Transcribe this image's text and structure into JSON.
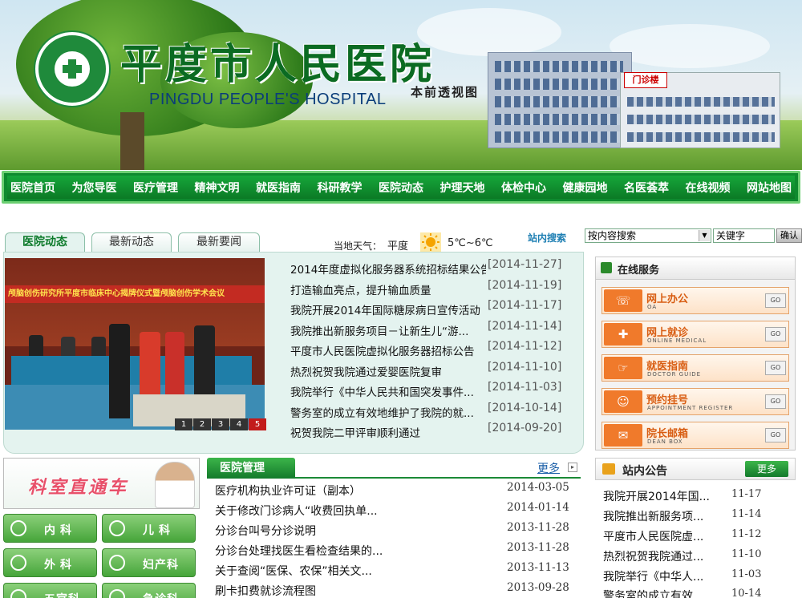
{
  "header": {
    "title_cn": "平度市人民医院",
    "title_en": "PINGDU PEOPLE'S  HOSPITAL",
    "building_sign": "门诊楼",
    "sign_caption": "本前透视图"
  },
  "nav": {
    "items": [
      "医院首页",
      "为您导医",
      "医疗管理",
      "精神文明",
      "就医指南",
      "科研教学",
      "医院动态",
      "护理天地",
      "体检中心",
      "健康园地",
      "名医荟萃",
      "在线视频",
      "网站地图"
    ]
  },
  "weather": {
    "label": "当地天气：",
    "city": "平度",
    "temp": "5℃~6℃"
  },
  "search": {
    "label": "站内搜索",
    "select_value": "按内容搜索",
    "input_value": "关键字",
    "button_label": "确认"
  },
  "tabs": [
    "医院动态",
    "最新动态",
    "最新要闻"
  ],
  "slide": {
    "banner_text": "颅脑创伤研究所平度市临床中心揭牌仪式暨颅脑创伤学术会议",
    "pages": [
      "1",
      "2",
      "3",
      "4",
      "5"
    ],
    "active_page": 5
  },
  "news": [
    {
      "title": "2014年度虚拟化服务器系统招标结果公告",
      "date": "[2014-11-27]"
    },
    {
      "title": "打造输血亮点，提升输血质量",
      "date": "[2014-11-19]"
    },
    {
      "title": "我院开展2014年国际糖尿病日宣传活动",
      "date": "[2014-11-17]"
    },
    {
      "title": "我院推出新服务项目－让新生儿“游...",
      "date": "[2014-11-14]"
    },
    {
      "title": "平度市人民医院虚拟化服务器招标公告",
      "date": "[2014-11-12]"
    },
    {
      "title": "热烈祝贺我院通过爱婴医院复审",
      "date": "[2014-11-10]"
    },
    {
      "title": "我院举行《中华人民共和国突发事件...",
      "date": "[2014-11-03]"
    },
    {
      "title": "警务室的成立有效地维护了我院的就...",
      "date": "[2014-10-14]"
    },
    {
      "title": "祝贺我院二甲评审顺利通过",
      "date": "[2014-09-20]"
    }
  ],
  "online_service": {
    "title": "在线服务",
    "items": [
      {
        "name": "网上办公",
        "sub": "OA",
        "go": "GO"
      },
      {
        "name": "网上就诊",
        "sub": "ONLINE MEDICAL",
        "go": "GO"
      },
      {
        "name": "就医指南",
        "sub": "DOCTOR GUIDE",
        "go": "GO"
      },
      {
        "name": "预约挂号",
        "sub": "APPOINTMENT REGISTER",
        "go": "GO"
      },
      {
        "name": "院长邮箱",
        "sub": "DEAN BOX",
        "go": "GO"
      }
    ]
  },
  "departments": {
    "title": "科室直通车",
    "items": [
      "内科",
      "儿科",
      "外科",
      "妇产科",
      "五官科",
      "急诊科"
    ]
  },
  "management": {
    "title": "医院管理",
    "more": "更多",
    "rows": [
      {
        "title": "医疗机构执业许可证（副本）",
        "date": "2014-03-05"
      },
      {
        "title": "关于修改门诊病人“收费回执单...",
        "date": "2014-01-14"
      },
      {
        "title": "分诊台叫号分诊说明",
        "date": "2013-11-28"
      },
      {
        "title": "分诊台处理找医生看检查结果的...",
        "date": "2013-11-28"
      },
      {
        "title": "关于查阅“医保、农保”相关文...",
        "date": "2013-11-13"
      },
      {
        "title": "刷卡扣费就诊流程图",
        "date": "2013-09-28"
      }
    ]
  },
  "notice": {
    "title": "站内公告",
    "more": "更多",
    "rows": [
      {
        "title": "我院开展2014年国...",
        "date": "11-17"
      },
      {
        "title": "我院推出新服务项...",
        "date": "11-14"
      },
      {
        "title": "平度市人民医院虚...",
        "date": "11-12"
      },
      {
        "title": "热烈祝贺我院通过...",
        "date": "11-10"
      },
      {
        "title": "我院举行《中华人...",
        "date": "11-03"
      },
      {
        "title": "警务室的成立有效...",
        "date": "10-14"
      }
    ]
  },
  "colors": {
    "brand_green": "#0e8a2e",
    "accent_orange": "#f07a2b",
    "pager_active": "#c21b1b"
  }
}
